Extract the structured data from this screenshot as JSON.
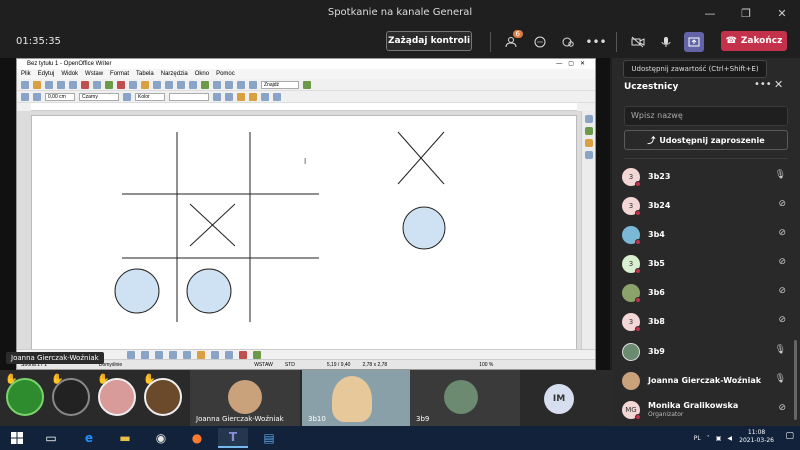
{
  "window": {
    "title": "Spotkanie na kanale General",
    "controls": [
      "—",
      "❐",
      "✕"
    ]
  },
  "toolbar": {
    "timer": "01:35:35",
    "request_control_label": "Zażądaj kontroli",
    "participants_badge": "6",
    "leave_label": "Zakończ",
    "share_tooltip": "Udostępnij zawartość (Ctrl+Shift+E)"
  },
  "shared_app": {
    "title": "Bez tytułu 1 - OpenOffice Writer",
    "menu": [
      "Plik",
      "Edytuj",
      "Widok",
      "Wstaw",
      "Format",
      "Tabela",
      "Narzędzia",
      "Okno",
      "Pomoc"
    ],
    "search_placeholder": "Znajdź",
    "line_width": "0,00 cm",
    "line_color": "Czarny",
    "area_mode": "Kolor",
    "status": {
      "page": "Strona 1 / 1",
      "style": "Domyślnie",
      "mode": "WSTAW",
      "std": "STD",
      "position": "5,19 / 9,40",
      "size": "2,78 x 2,78",
      "zoom": "100 %"
    },
    "presenter": "Joanna Gierczak-Woźniak"
  },
  "gallery": {
    "tiles": [
      {
        "name": "Joanna Gierczak-Woźniak"
      },
      {
        "name": "3b10"
      },
      {
        "name": "3b9"
      }
    ],
    "im_initials": "IM"
  },
  "panel": {
    "title": "Uczestnicy",
    "search_placeholder": "Wpisz nazwę",
    "invite_label": "Udostępnij zaproszenie",
    "participants": [
      {
        "name": "3b23",
        "initial": "3",
        "color": "#f3d6d6",
        "mic": "on"
      },
      {
        "name": "3b24",
        "initial": "3",
        "color": "#f3d6d6",
        "mic": "muted"
      },
      {
        "name": "3b4",
        "initial": "",
        "color": "#7ab8d6",
        "mic": "muted"
      },
      {
        "name": "3b5",
        "initial": "3",
        "color": "#d8f0d0",
        "mic": "muted"
      },
      {
        "name": "3b6",
        "initial": "",
        "color": "#8ba36a",
        "mic": "muted"
      },
      {
        "name": "3b8",
        "initial": "3",
        "color": "#f3d6d6",
        "mic": "muted"
      },
      {
        "name": "3b9",
        "initial": "",
        "color": "#6c8a70",
        "mic": "on"
      },
      {
        "name": "Joanna Gierczak-Woźniak",
        "initial": "",
        "color": "#c9a27c",
        "mic": "on"
      },
      {
        "name": "Monika Gralikowska",
        "initial": "MG",
        "color": "#f3d6d6",
        "mic": "muted",
        "role": "Organizator"
      }
    ]
  },
  "taskbar": {
    "lang": "PL",
    "time": "11:08",
    "date": "2021-03-26"
  }
}
